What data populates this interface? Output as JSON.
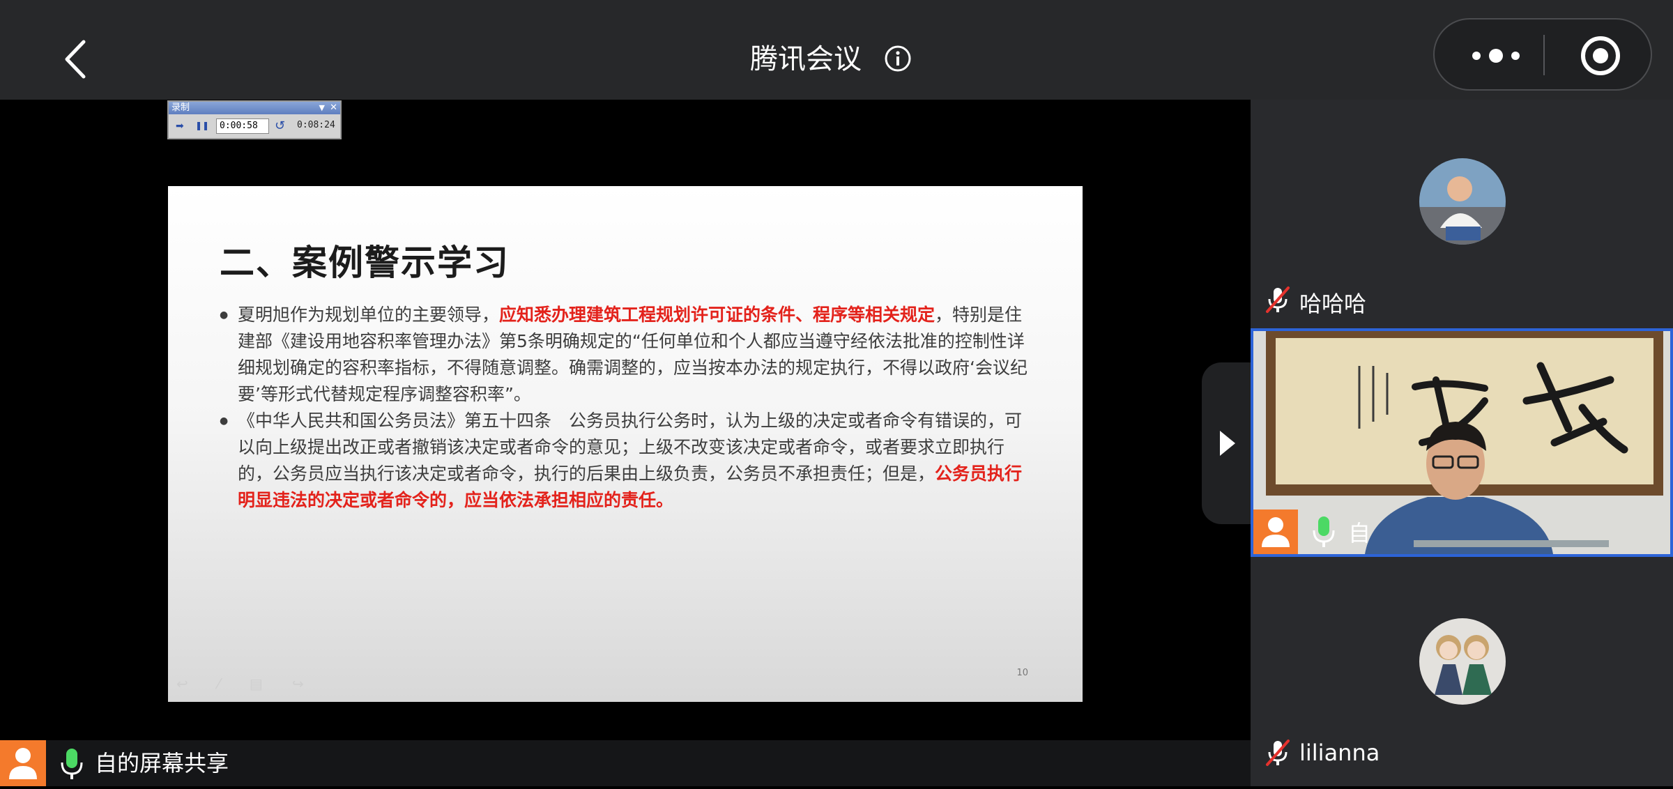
{
  "header": {
    "title": "腾讯会议",
    "back_icon": "chevron-left-icon",
    "info_icon": "info-icon",
    "more_icon": "more-dots-icon",
    "close_icon": "close-miniprogram-icon"
  },
  "recording_toolbar": {
    "title": "录制",
    "current_time": "0:00:58",
    "total_time": "0:08:24"
  },
  "slide": {
    "title": "二、案例警示学习",
    "bullets": [
      {
        "before": "夏明旭作为规划单位的主要领导，",
        "highlight": "应知悉办理建筑工程规划许可证的条件、程序等相关规定",
        "after": "，特别是住建部《建设用地容积率管理办法》第5条明确规定的“任何单位和个人都应当遵守经依法批准的控制性详细规划确定的容积率指标，不得随意调整。确需调整的，应当按本办法的规定执行，不得以政府‘会议纪要’等形式代替规定程序调整容积率”。"
      },
      {
        "before": "《中华人民共和国公务员法》第五十四条　公务员执行公务时，认为上级的决定或者命令有错误的，可以向上级提出改正或者撤销该决定或者命令的意见；上级不改变该决定或者命令，或者要求立即执行的，公务员应当执行该决定或者命令，执行的后果由上级负责，公务员不承担责任；但是，",
        "highlight": "公务员执行明显违法的决定或者命令的，应当依法承担相应的责任。",
        "after": ""
      }
    ],
    "page_number": "10"
  },
  "participants": [
    {
      "name": "哈哈哈",
      "mic": "muted"
    },
    {
      "name": "自",
      "mic": "active"
    },
    {
      "name": "lilianna",
      "mic": "muted"
    }
  ],
  "bottom_bar": {
    "label": "自的屏幕共享",
    "mic": "active"
  },
  "colors": {
    "top_bar": "#27282a",
    "sidebar": "#292a2d",
    "accent_orange": "#f47a2c",
    "active_border": "#2d64d8",
    "highlight_red": "#e3221b",
    "mic_green": "#4cd964"
  }
}
